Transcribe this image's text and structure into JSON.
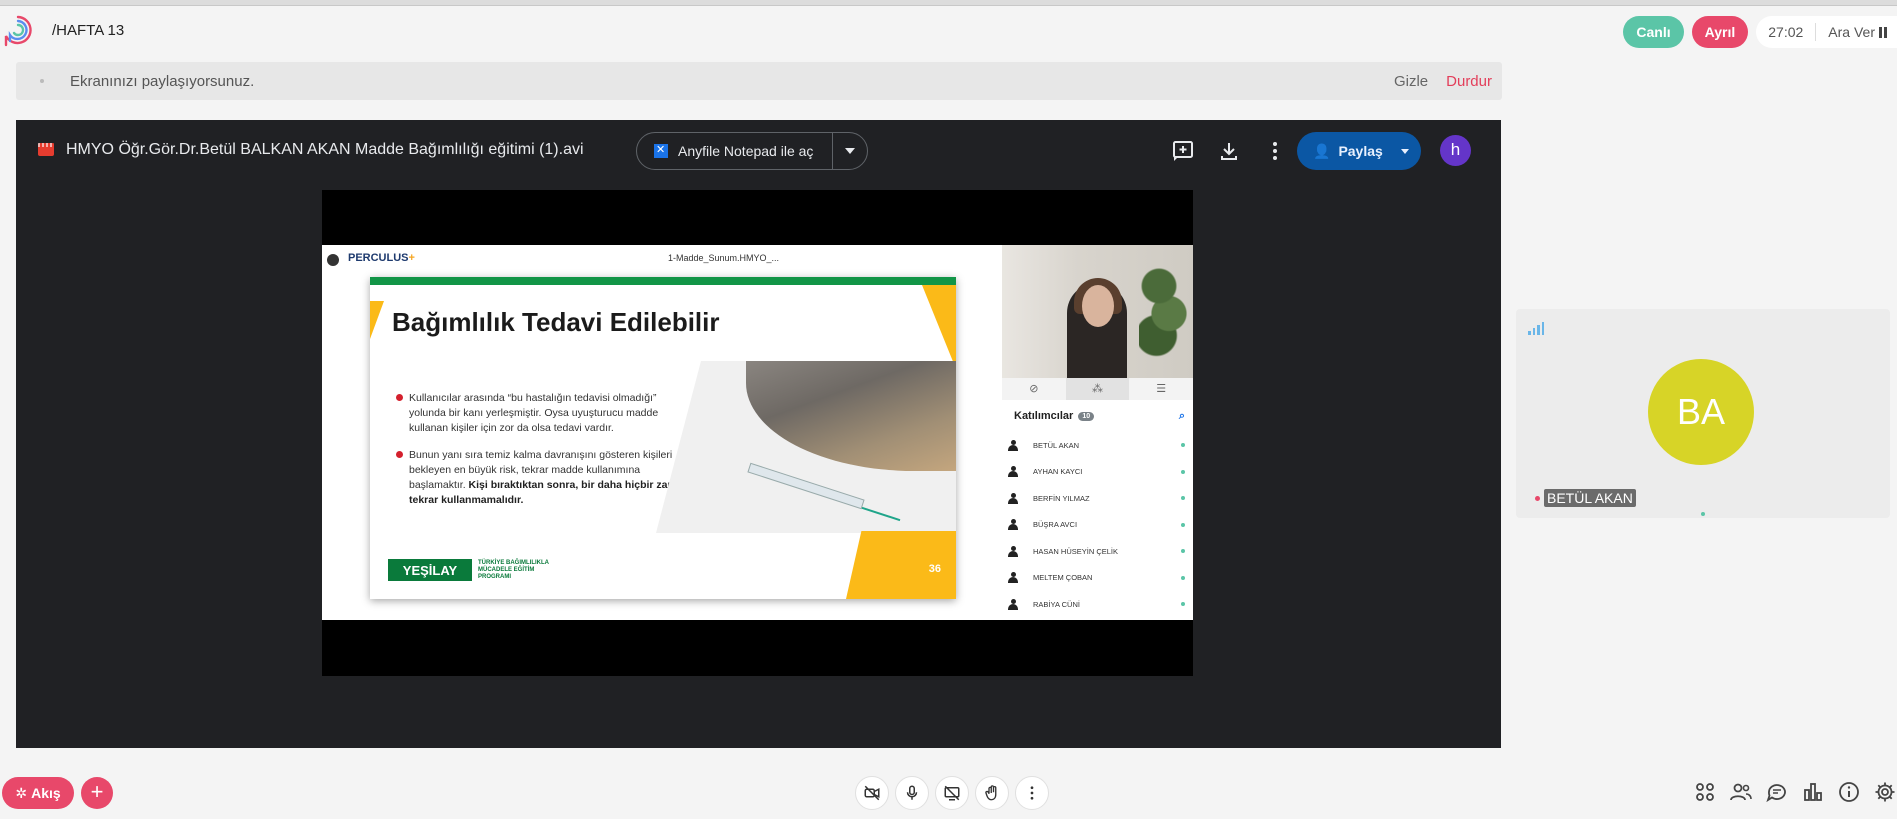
{
  "header": {
    "course": "/HAFTA 13",
    "live_label": "Canlı",
    "leave_label": "Ayrıl",
    "timer": "27:02",
    "break_label": "Ara Ver"
  },
  "share_banner": {
    "message": "Ekranınızı paylaşıyorsunuz.",
    "hide_label": "Gizle",
    "stop_label": "Durdur"
  },
  "drive_viewer": {
    "file_name": "HMYO Öğr.Gör.Dr.Betül BALKAN AKAN Madde Bağımlılığı eğitimi (1).avi",
    "open_with_label": "Anyfile Notepad ile aç",
    "share_label": "Paylaş",
    "account_initial": "h"
  },
  "video": {
    "app_name": "PERCULUS",
    "app_plus": "+",
    "session_title": "1-Madde_Sunum.HMYO_...",
    "slide": {
      "heading": "Bağımlılık Tedavi Edilebilir",
      "bullet1": "Kullanıcılar arasında “bu hastalığın tedavisi olmadığı” yolunda bir kanı yerleşmiştir. Oysa uyuşturucu madde kullanan kişiler için zor da olsa tedavi vardır.",
      "bullet2_normal": "Bunun yanı sıra temiz kalma davranışını gösteren kişileri bekleyen en büyük risk, tekrar madde kullanımına başlamaktır.",
      "bullet2_bold": "Kişi bıraktıktan sonra, bir daha hiçbir zaman tekrar kullanmamalıdır.",
      "brand": "YEŞİLAY",
      "brand_sub": "TÜRKİYE BAĞIMLILIKLA MÜCADELE EĞİTİM PROGRAMI",
      "page_number": "36"
    },
    "participants": {
      "title": "Katılımcılar",
      "count": "10",
      "names": [
        "BETÜL AKAN",
        "AYHAN KAYCI",
        "BERFİN YILMAZ",
        "BÜŞRA AVCI",
        "HASAN HÜSEYİN ÇELİK",
        "MELTEM ÇOBAN",
        "RABİYA CÜNİ"
      ]
    }
  },
  "side_participant": {
    "initials": "BA",
    "name": "BETÜL AKAN"
  },
  "footer": {
    "flow_label": "Akış"
  },
  "colors": {
    "live_green": "#5bc5a7",
    "accent_pink": "#e8486a",
    "drive_blue": "#0b57a4",
    "avatar_yellow": "#d7d427"
  }
}
